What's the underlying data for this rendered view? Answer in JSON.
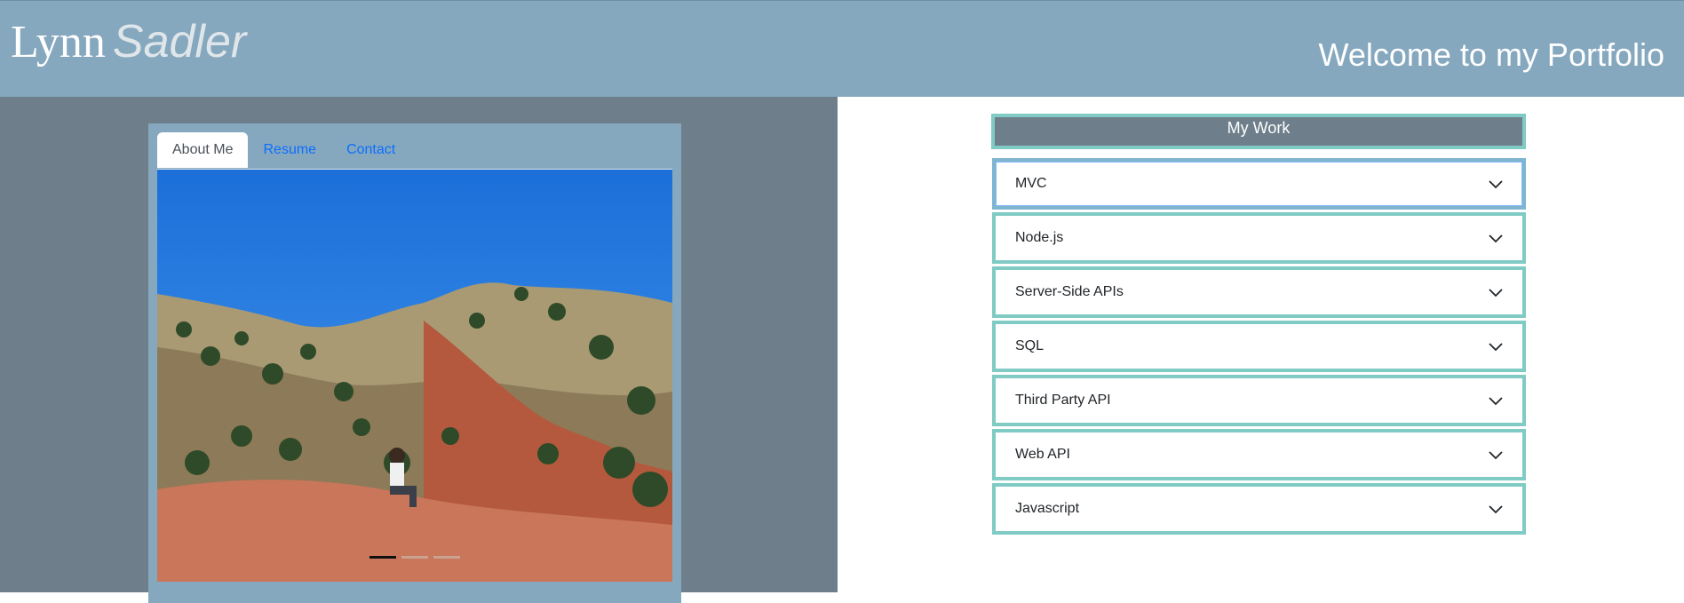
{
  "header": {
    "first_name": "Lynn",
    "last_name": "Sadler",
    "welcome": "Welcome to my Portfolio"
  },
  "tabs": [
    {
      "label": "About Me",
      "active": true
    },
    {
      "label": "Resume",
      "active": false
    },
    {
      "label": "Contact",
      "active": false
    }
  ],
  "carousel": {
    "image_description_icon": "landscape-photo",
    "slide_count": 3,
    "active_slide": 1
  },
  "work": {
    "title": "My Work",
    "items": [
      {
        "label": "MVC"
      },
      {
        "label": "Node.js"
      },
      {
        "label": "Server-Side APIs"
      },
      {
        "label": "SQL"
      },
      {
        "label": "Third Party API"
      },
      {
        "label": "Web API"
      },
      {
        "label": "Javascript"
      }
    ]
  },
  "colors": {
    "header_bg": "#85a8bf",
    "left_pane_bg": "#6e7f8b",
    "accordion_border": "#80cbc4",
    "link": "#0d6efd"
  }
}
